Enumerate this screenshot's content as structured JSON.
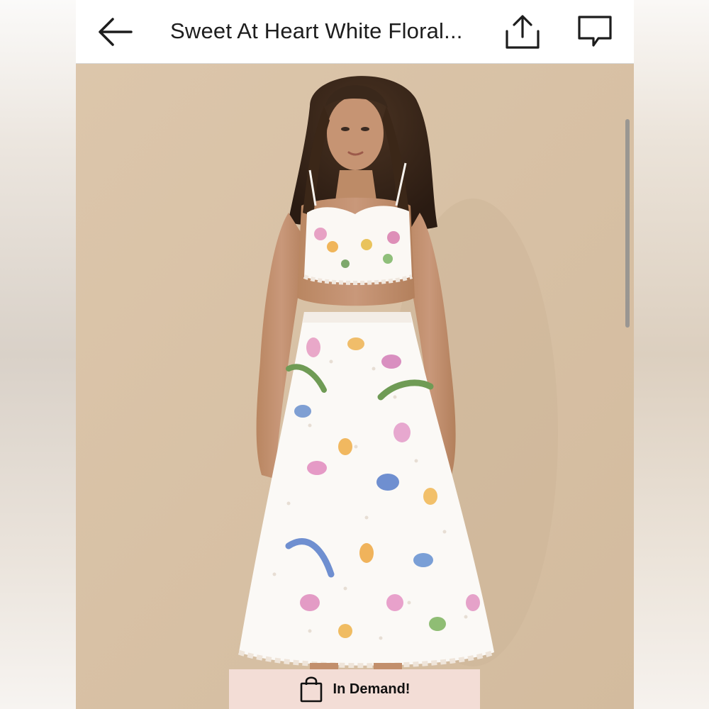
{
  "header": {
    "title": "Sweet At Heart White Floral..."
  },
  "icons": {
    "back": "arrow-left-icon",
    "share": "share-upload-icon",
    "comment": "comment-bubble-icon",
    "bag": "shopping-bag-icon"
  },
  "badge": {
    "label": "In Demand!"
  },
  "colors": {
    "background": "#d9c3a8",
    "badge_bg": "#f3ddd6",
    "header_bg": "#ffffff",
    "text": "#1d1d1d"
  }
}
